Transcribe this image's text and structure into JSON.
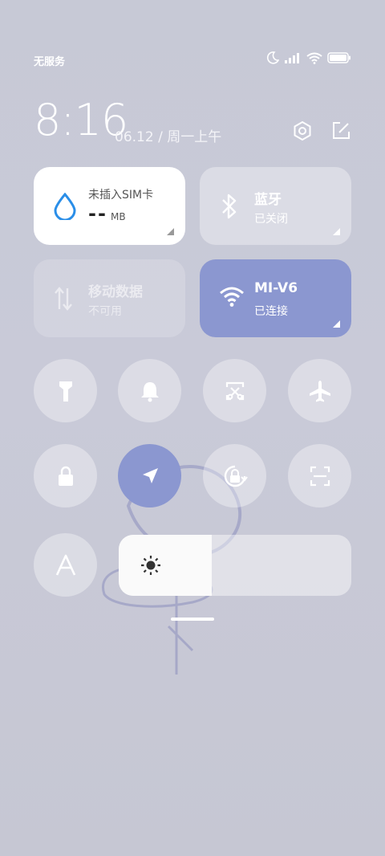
{
  "status_bar": {
    "carrier": "无服务"
  },
  "clock": {
    "time": "8:16",
    "date": "06.12 / 周一上午"
  },
  "tiles": {
    "sim": {
      "title": "未插入SIM卡",
      "value": "--",
      "unit": "MB"
    },
    "bluetooth": {
      "title": "蓝牙",
      "status": "已关闭"
    },
    "mobile_data": {
      "title": "移动数据",
      "status": "不可用"
    },
    "wifi": {
      "title": "MI-V6",
      "status": "已连接"
    }
  },
  "toggles": {
    "row1": [
      "flashlight-icon",
      "bell-icon",
      "screenshot-icon",
      "airplane-icon"
    ],
    "row2": [
      "lock-icon",
      "location-icon",
      "rotation-lock-icon",
      "scanner-icon"
    ],
    "row3": [
      "font-size-icon"
    ]
  },
  "brightness": {
    "level": 0.4
  },
  "colors": {
    "accent": "#8b97d0",
    "sim_drop": "#2a8ee8"
  }
}
